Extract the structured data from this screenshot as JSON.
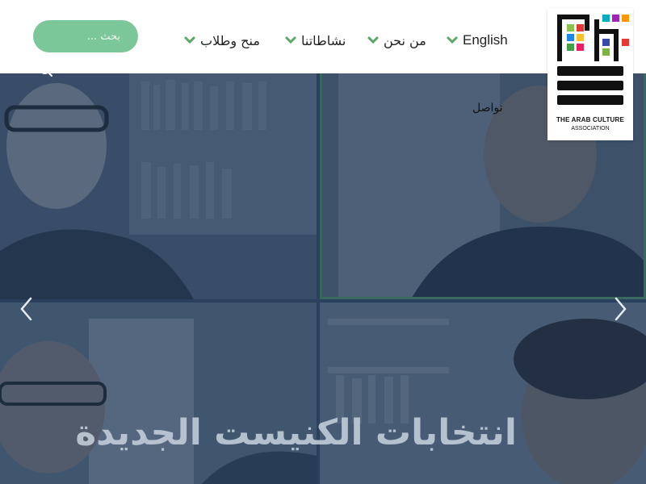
{
  "header": {
    "search_placeholder": "بحث ...",
    "nav": {
      "english": "English",
      "about": "من نحن",
      "activities": "نشاطاتنا",
      "grants": "منح وطلاب",
      "contact": "تواصل"
    },
    "logo": {
      "arabic_lines": [
        "جمعية",
        "الثقافة",
        "العربية"
      ],
      "english_line1": "THE ARAB CULTURE",
      "english_line2": "ASSOCIATION",
      "tile_colors": [
        "#8bc34a",
        "#e53935",
        "#1e88e5",
        "#fbc02d",
        "#43a047",
        "#e91e63",
        "#00acc1",
        "#9c27b0",
        "#ff9800",
        "#3949ab",
        "#7cb342",
        "#e53935"
      ]
    },
    "accent_color": "#7cc79a"
  },
  "hero": {
    "title": "انتخابات الكنيست الجديدة",
    "name_tag": "★★ ★★★★",
    "overlay_color": "#1c3458",
    "highlight_border_color": "#5aa867"
  },
  "icons": {
    "search": "search-icon",
    "chevron": "chevron-down-icon",
    "prev": "chevron-left-icon",
    "next": "chevron-right-icon"
  }
}
